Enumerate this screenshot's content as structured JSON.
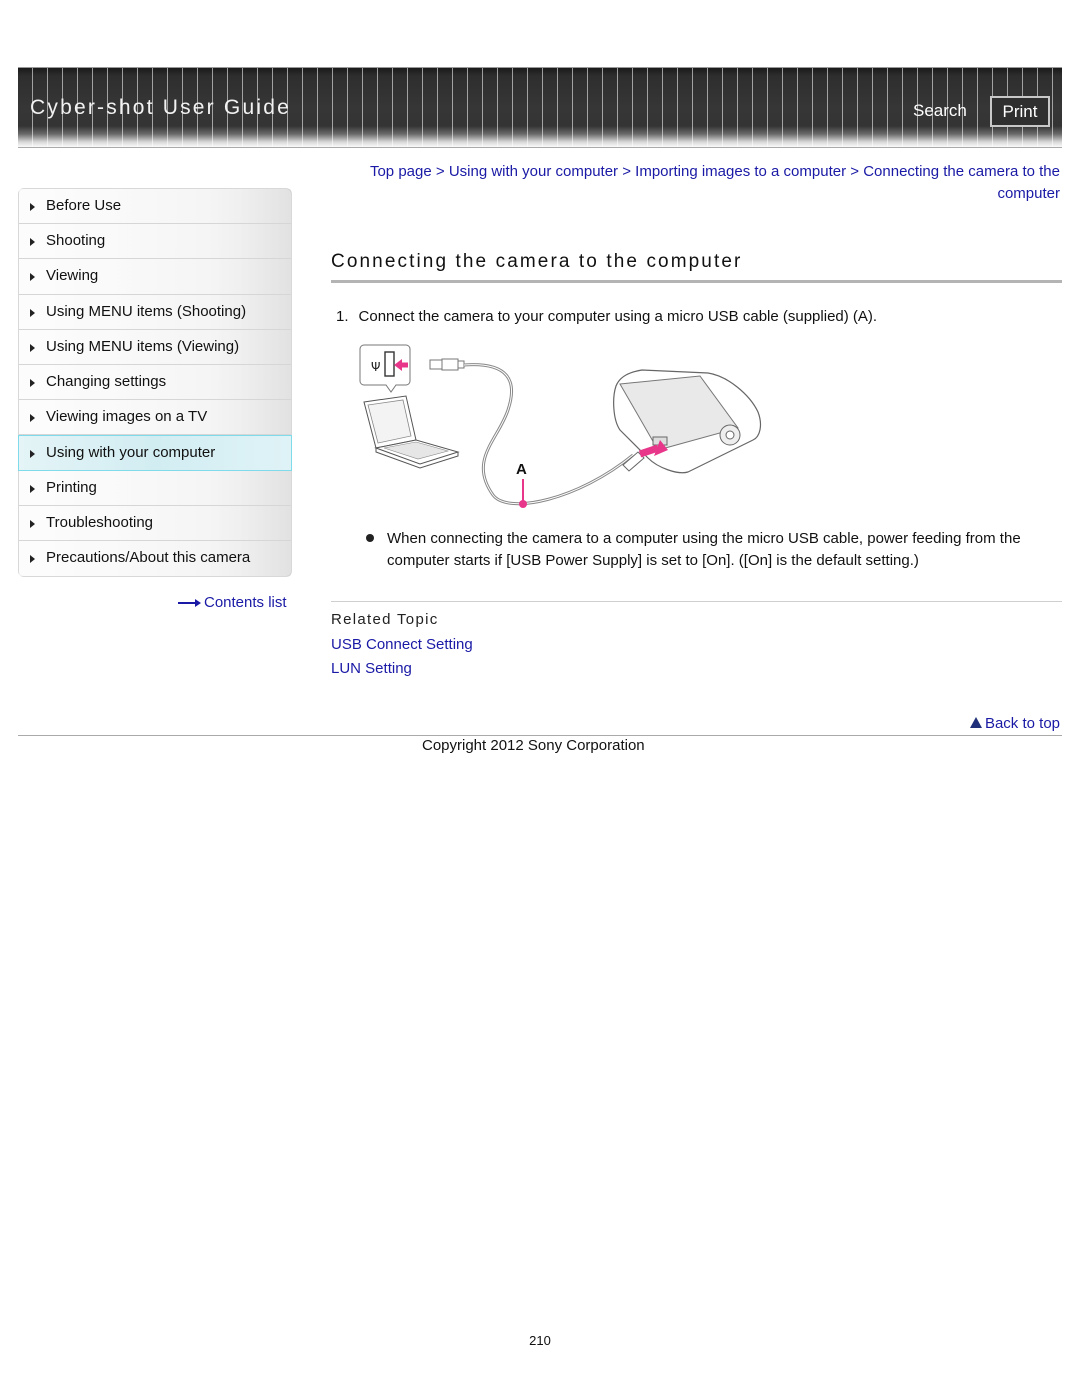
{
  "header": {
    "title": "Cyber-shot User Guide",
    "search_label": "Search",
    "print_label": "Print"
  },
  "sidebar": {
    "items": [
      {
        "label": "Before Use",
        "active": false
      },
      {
        "label": "Shooting",
        "active": false
      },
      {
        "label": "Viewing",
        "active": false
      },
      {
        "label": "Using MENU items (Shooting)",
        "active": false
      },
      {
        "label": "Using MENU items (Viewing)",
        "active": false
      },
      {
        "label": "Changing settings",
        "active": false
      },
      {
        "label": "Viewing images on a TV",
        "active": false
      },
      {
        "label": "Using with your computer",
        "active": true
      },
      {
        "label": "Printing",
        "active": false
      },
      {
        "label": "Troubleshooting",
        "active": false
      },
      {
        "label": "Precautions/About this camera",
        "active": false
      }
    ],
    "contents_link": "Contents list"
  },
  "breadcrumb": {
    "items": [
      "Top page",
      "Using with your computer",
      "Importing images to a computer",
      "Connecting the camera to the computer"
    ],
    "separator": ">"
  },
  "main": {
    "title": "Connecting the camera to the computer",
    "step": {
      "number": "1.",
      "text": "Connect the camera to your computer using a micro USB cable (supplied) (A)."
    },
    "illustration": {
      "callout_label": "A",
      "accent_color": "#e8378a"
    },
    "note": "When connecting the camera to a computer using the micro USB cable, power feeding from the computer starts if [USB Power Supply] is set to [On]. ([On] is the default setting.)",
    "related": {
      "title": "Related Topic",
      "links": [
        "USB Connect Setting",
        "LUN Setting"
      ]
    },
    "back_to_top": "Back to top"
  },
  "footer": {
    "copyright": "Copyright 2012 Sony Corporation",
    "page_number": "210"
  },
  "colors": {
    "link": "#1a1aa6",
    "active_nav": "#d2edf2",
    "header_bg": "#343434"
  }
}
